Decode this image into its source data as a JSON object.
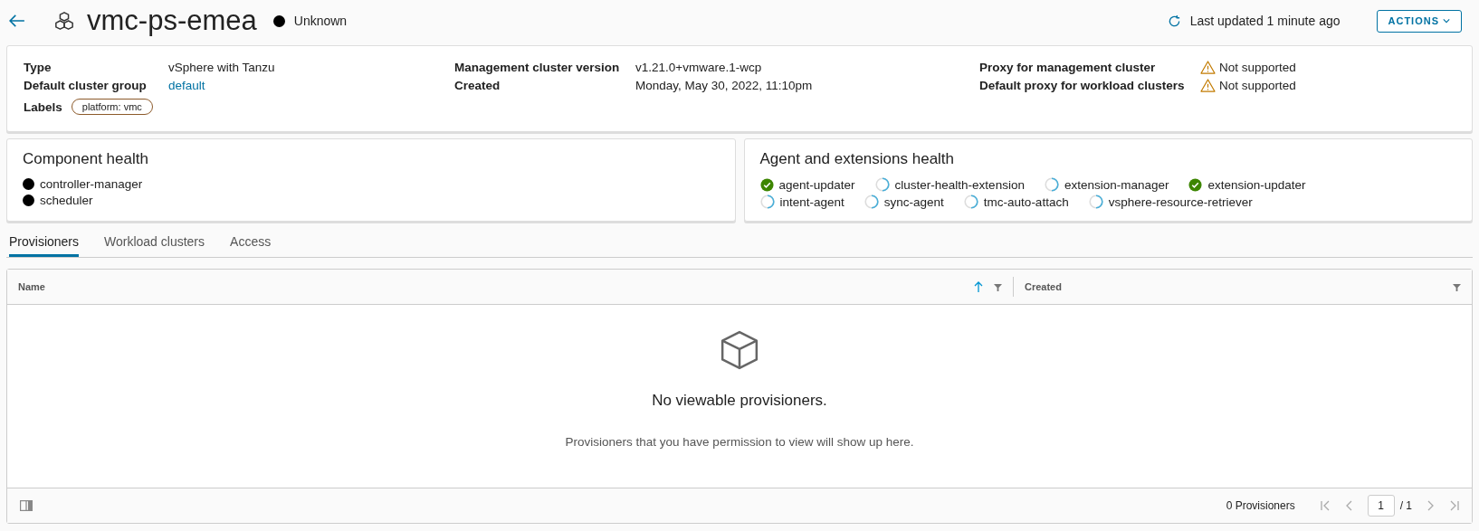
{
  "header": {
    "title": "vmc-ps-emea",
    "status": {
      "label": "Unknown",
      "kind": "unknown"
    },
    "last_updated": "Last updated 1 minute ago",
    "actions_button": "ACTIONS"
  },
  "details": {
    "columns": [
      [
        {
          "label": "Type",
          "value": "vSphere with Tanzu",
          "kind": "text"
        },
        {
          "label": "Default cluster group",
          "value": "default",
          "kind": "link"
        },
        {
          "label": "Labels",
          "value": "platform: vmc",
          "kind": "tag"
        }
      ],
      [
        {
          "label": "Management cluster version",
          "value": "v1.21.0+vmware.1-wcp",
          "kind": "text"
        },
        {
          "label": "Created",
          "value": "Monday, May 30, 2022, 11:10pm",
          "kind": "text"
        }
      ],
      [
        {
          "label": "Proxy for management cluster",
          "value": "Not supported",
          "kind": "warning"
        },
        {
          "label": "Default proxy for workload clusters",
          "value": "Not supported",
          "kind": "warning"
        }
      ]
    ]
  },
  "component_health": {
    "title": "Component health",
    "items": [
      {
        "name": "controller-manager",
        "kind": "unknown"
      },
      {
        "name": "scheduler",
        "kind": "unknown"
      }
    ]
  },
  "agent_health": {
    "title": "Agent and extensions health",
    "items": [
      {
        "name": "agent-updater",
        "kind": "ok"
      },
      {
        "name": "cluster-health-extension",
        "kind": "pending"
      },
      {
        "name": "extension-manager",
        "kind": "pending"
      },
      {
        "name": "extension-updater",
        "kind": "ok"
      },
      {
        "name": "intent-agent",
        "kind": "pending"
      },
      {
        "name": "sync-agent",
        "kind": "pending"
      },
      {
        "name": "tmc-auto-attach",
        "kind": "pending"
      },
      {
        "name": "vsphere-resource-retriever",
        "kind": "pending"
      }
    ]
  },
  "tabs": [
    {
      "label": "Provisioners",
      "selected": true
    },
    {
      "label": "Workload clusters",
      "selected": false
    },
    {
      "label": "Access",
      "selected": false
    }
  ],
  "table": {
    "columns": [
      {
        "label": "Name",
        "sorted": true
      },
      {
        "label": "Created",
        "sorted": false
      }
    ],
    "empty_title": "No viewable provisioners.",
    "empty_message": "Provisioners that you have permission to view will show up here.",
    "footer": {
      "count": "0 Provisioners",
      "page": "1",
      "total": "/ 1"
    }
  }
}
